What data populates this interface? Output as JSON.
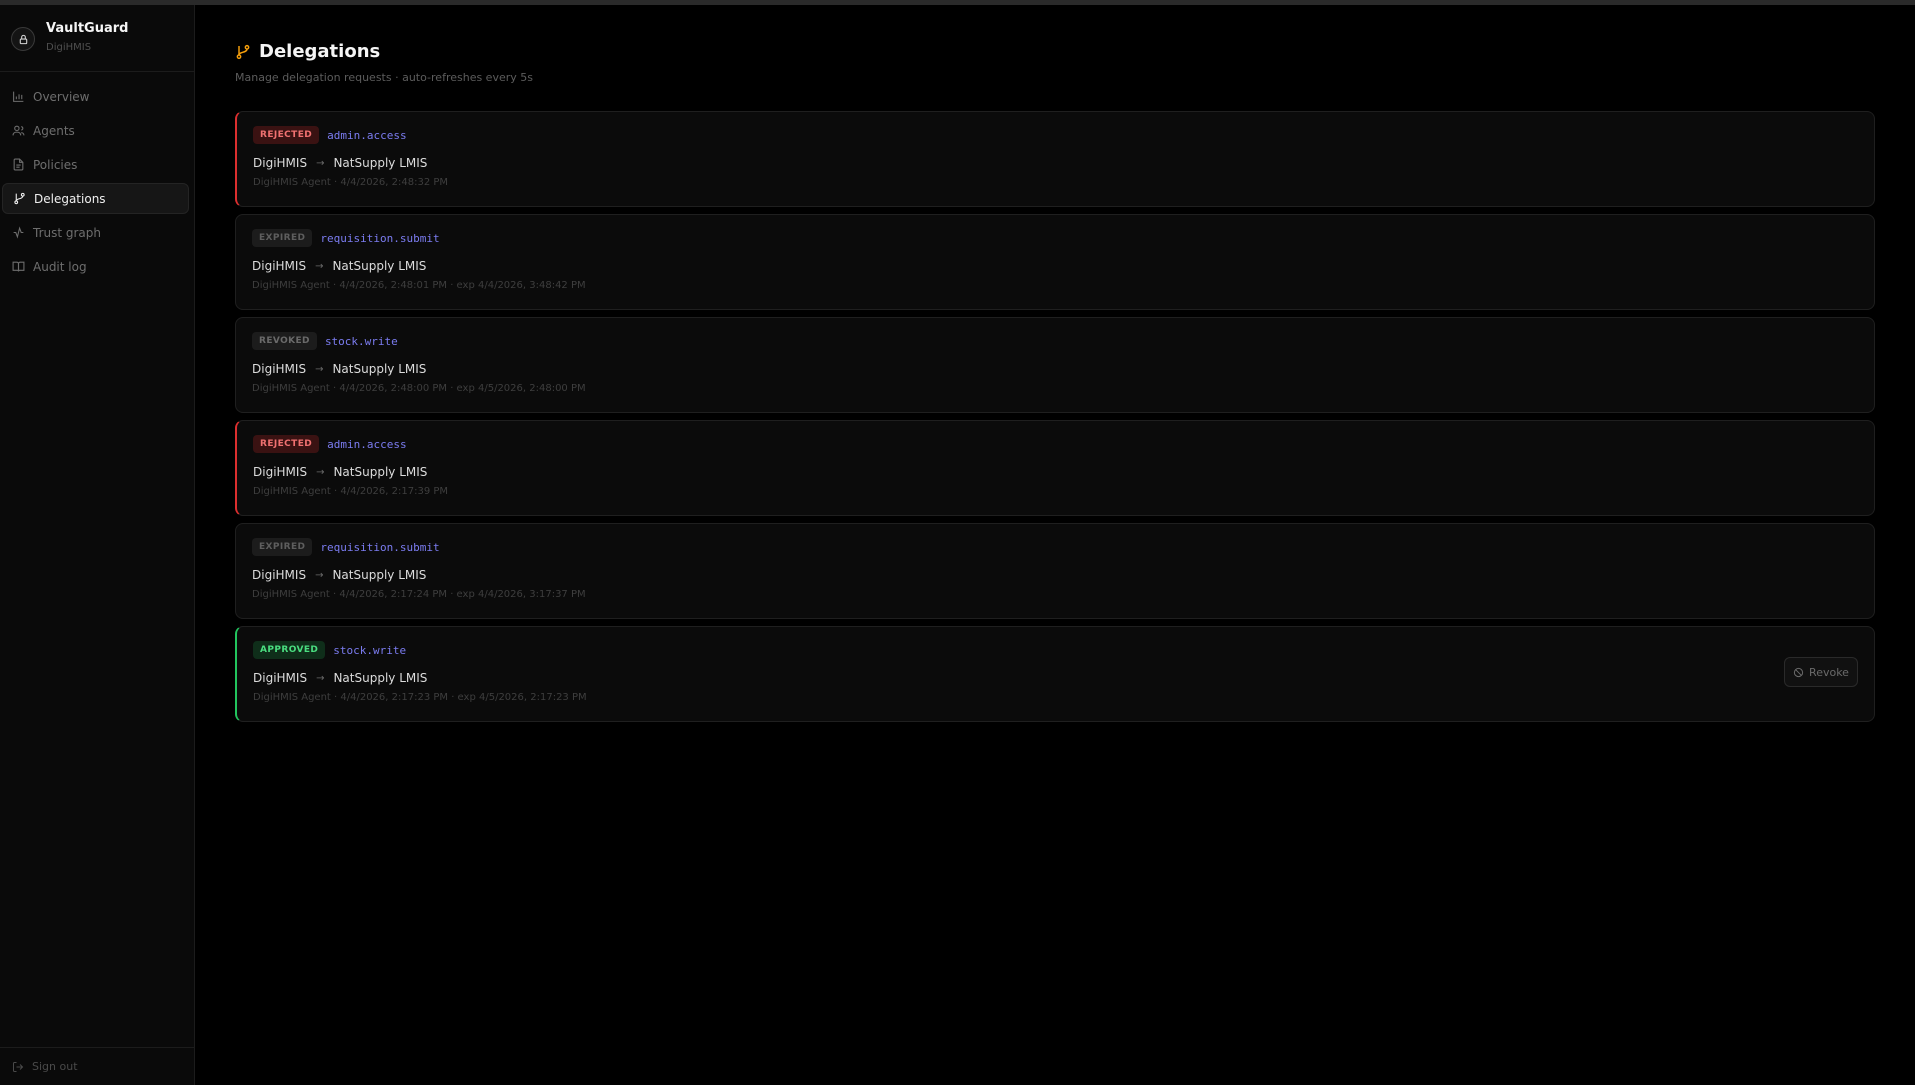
{
  "app": {
    "name": "VaultGuard",
    "org": "DigiHMIS"
  },
  "sidebar": {
    "items": [
      {
        "label": "Overview",
        "icon": "bar-chart-icon",
        "active": false
      },
      {
        "label": "Agents",
        "icon": "users-icon",
        "active": false
      },
      {
        "label": "Policies",
        "icon": "document-icon",
        "active": false
      },
      {
        "label": "Delegations",
        "icon": "git-branch-icon",
        "active": true
      },
      {
        "label": "Trust graph",
        "icon": "activity-icon",
        "active": false
      },
      {
        "label": "Audit log",
        "icon": "book-icon",
        "active": false
      }
    ],
    "signout_label": "Sign out"
  },
  "page": {
    "title": "Delegations",
    "subtitle": "Manage delegation requests · auto-refreshes every 5s"
  },
  "delegations": [
    {
      "status": "REJECTED",
      "permission": "admin.access",
      "from": "DigiHMIS",
      "to": "NatSupply LMIS",
      "meta": "DigiHMIS Agent · 4/4/2026, 2:48:32 PM"
    },
    {
      "status": "EXPIRED",
      "permission": "requisition.submit",
      "from": "DigiHMIS",
      "to": "NatSupply LMIS",
      "meta": "DigiHMIS Agent · 4/4/2026, 2:48:01 PM · exp 4/4/2026, 3:48:42 PM"
    },
    {
      "status": "REVOKED",
      "permission": "stock.write",
      "from": "DigiHMIS",
      "to": "NatSupply LMIS",
      "meta": "DigiHMIS Agent · 4/4/2026, 2:48:00 PM · exp 4/5/2026, 2:48:00 PM"
    },
    {
      "status": "REJECTED",
      "permission": "admin.access",
      "from": "DigiHMIS",
      "to": "NatSupply LMIS",
      "meta": "DigiHMIS Agent · 4/4/2026, 2:17:39 PM"
    },
    {
      "status": "EXPIRED",
      "permission": "requisition.submit",
      "from": "DigiHMIS",
      "to": "NatSupply LMIS",
      "meta": "DigiHMIS Agent · 4/4/2026, 2:17:24 PM · exp 4/4/2026, 3:17:37 PM"
    },
    {
      "status": "APPROVED",
      "permission": "stock.write",
      "from": "DigiHMIS",
      "to": "NatSupply LMIS",
      "meta": "DigiHMIS Agent · 4/4/2026, 2:17:23 PM · exp 4/5/2026, 2:17:23 PM",
      "action": "Revoke"
    }
  ],
  "colors": {
    "accent": "#f59e0b",
    "rejected": "#dc2f2f",
    "approved": "#22c55e",
    "permission": "#7b7cf0"
  }
}
